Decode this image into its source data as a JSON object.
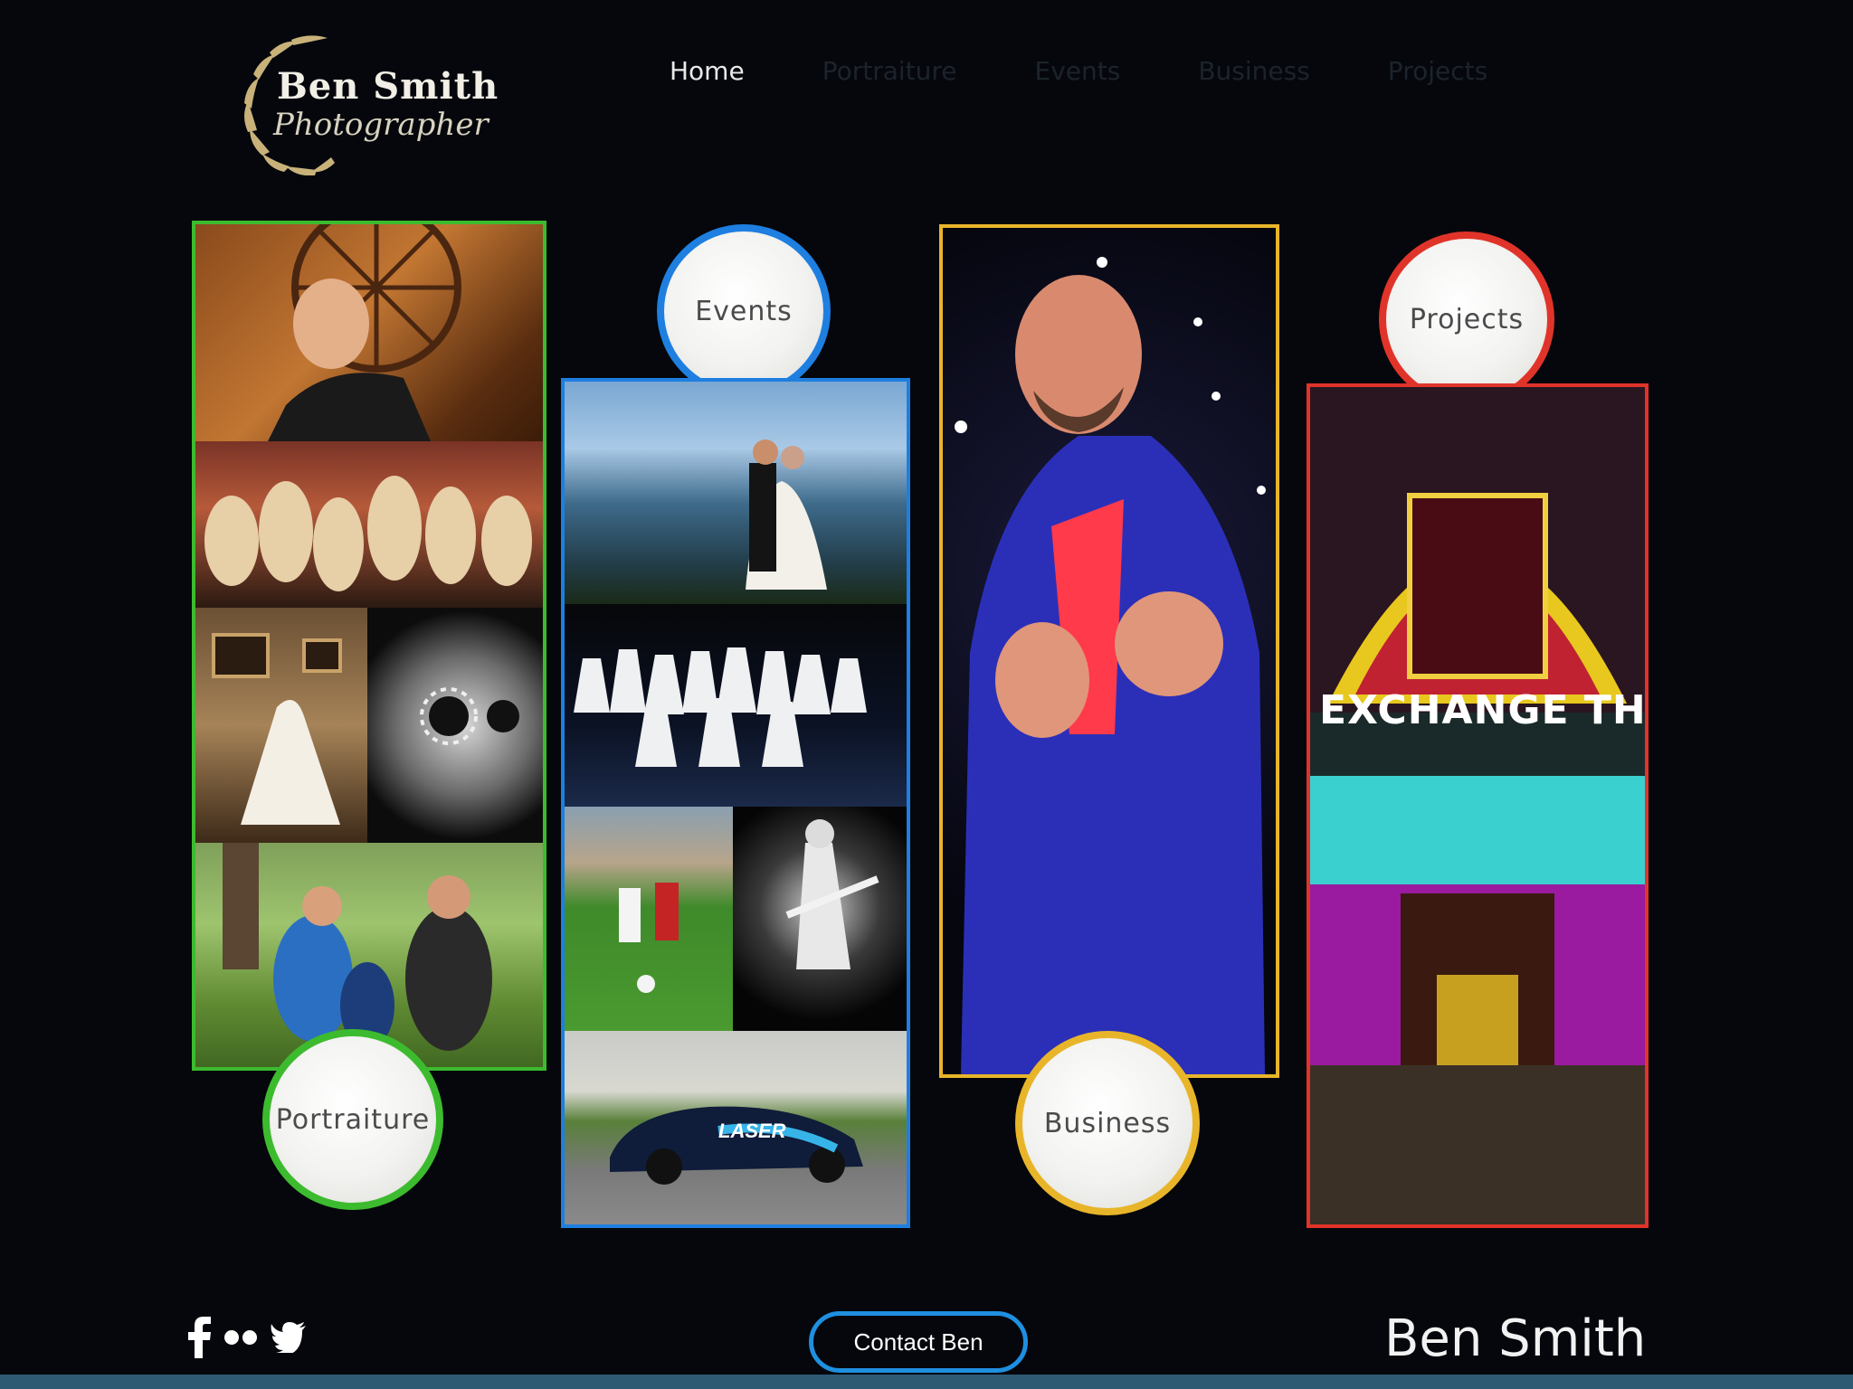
{
  "brand": {
    "name": "Ben Smith",
    "tagline": "Photographer",
    "accent": "#c9b27a"
  },
  "nav": {
    "items": [
      {
        "label": "Home",
        "active": true
      },
      {
        "label": "Portraiture",
        "active": false
      },
      {
        "label": "Events",
        "active": false
      },
      {
        "label": "Business",
        "active": false
      },
      {
        "label": "Projects",
        "active": false
      }
    ]
  },
  "gallery": {
    "portraiture": {
      "label": "Portraiture",
      "border_color": "#3dbb2f"
    },
    "events": {
      "label": "Events",
      "border_color": "#1e7fe0"
    },
    "business": {
      "label": "Business",
      "border_color": "#e8b52a"
    },
    "projects": {
      "label": "Projects",
      "border_color": "#e0342a"
    },
    "projects_sign": "EXCHANGE TH",
    "car_livery": "LASER"
  },
  "footer": {
    "social_icons": [
      "facebook-icon",
      "flickr-icon",
      "twitter-icon"
    ],
    "contact_label": "Contact Ben",
    "name": "Ben Smith"
  }
}
